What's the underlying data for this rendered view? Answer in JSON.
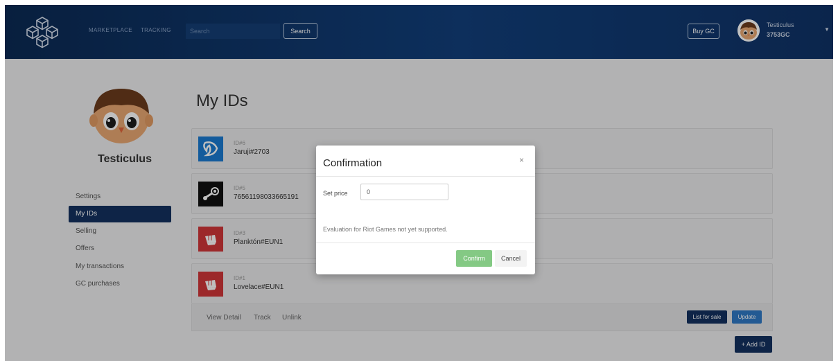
{
  "header": {
    "nav": [
      "MARKETPLACE",
      "TRACKING"
    ],
    "search_placeholder": "Search",
    "search_button": "Search",
    "buy_gc": "Buy GC",
    "username": "Testiculus",
    "balance": "3753GC"
  },
  "sidebar": {
    "username": "Testiculus",
    "items": [
      "Settings",
      "My IDs",
      "Selling",
      "Offers",
      "My transactions",
      "GC purchases"
    ],
    "active": "My IDs"
  },
  "main": {
    "title": "My IDs",
    "ids": [
      {
        "label": "ID#6",
        "value": "Jaruji#2703",
        "platform": "battlenet-icon",
        "color": "#1a7ad0"
      },
      {
        "label": "ID#5",
        "value": "76561198033665191",
        "platform": "steam-icon",
        "color": "#111111"
      },
      {
        "label": "ID#3",
        "value": "Planktón#EUN1",
        "platform": "riot-icon",
        "color": "#d13639"
      },
      {
        "label": "ID#1",
        "value": "Lovelace#EUN1",
        "platform": "riot-icon",
        "color": "#d13639"
      }
    ],
    "footer_links": [
      "View Detail",
      "Track",
      "Unlink"
    ],
    "list_for_sale": "List for sale",
    "update": "Update",
    "add_id": "+ Add ID"
  },
  "modal": {
    "title": "Confirmation",
    "close": "×",
    "price_label": "Set price",
    "price_value": "0",
    "evaluation_text": "Evaluation for Riot Games not yet supported.",
    "confirm": "Confirm",
    "cancel": "Cancel"
  }
}
